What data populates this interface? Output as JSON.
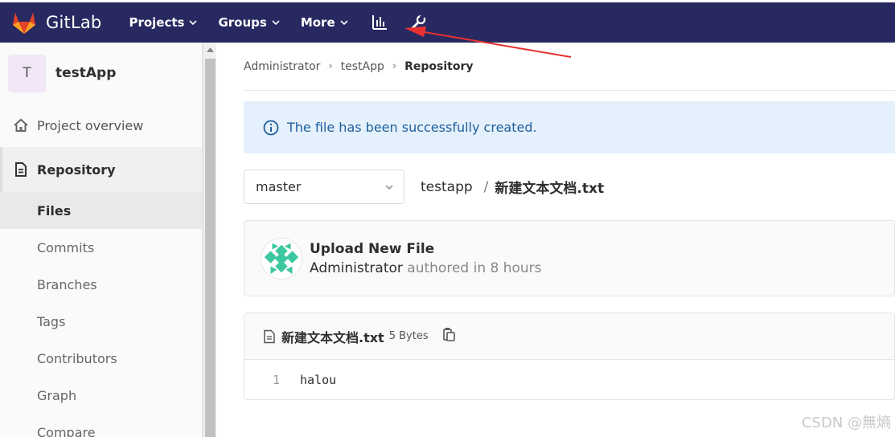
{
  "brand": {
    "name": "GitLab"
  },
  "nav": {
    "items": [
      {
        "label": "Projects"
      },
      {
        "label": "Groups"
      },
      {
        "label": "More"
      }
    ],
    "icons": [
      "chart-icon",
      "wrench-icon"
    ]
  },
  "sidebar": {
    "avatar_letter": "T",
    "project_name": "testApp",
    "overview_label": "Project overview",
    "repository_label": "Repository",
    "sub_items": [
      "Files",
      "Commits",
      "Branches",
      "Tags",
      "Contributors",
      "Graph",
      "Compare"
    ]
  },
  "breadcrumb": [
    "Administrator",
    "testApp",
    "Repository"
  ],
  "alert": {
    "message": "The file has been successfully created."
  },
  "tree": {
    "branch": "master",
    "root": "testapp",
    "file": "新建文本文档.txt"
  },
  "commit": {
    "title": "Upload New File",
    "author": "Administrator",
    "meta": "authored in 8 hours"
  },
  "file": {
    "name": "新建文本文档.txt",
    "size": "5 Bytes",
    "lines": [
      {
        "number": "1",
        "text": "halou"
      }
    ]
  },
  "watermark": "CSDN @無熵",
  "colors": {
    "navbar": "#292961",
    "alert_bg": "#e4f0fb",
    "alert_text": "#1f5f9e",
    "logo_orange": "#e24329",
    "annotation": "#e8312f"
  }
}
